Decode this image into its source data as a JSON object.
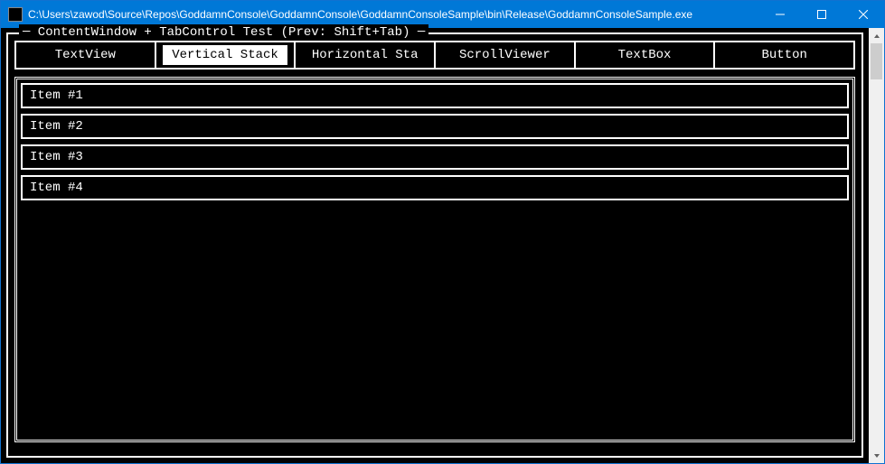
{
  "window": {
    "title": "C:\\Users\\zawod\\Source\\Repos\\GoddamnConsole\\GoddamnConsole\\GoddamnConsoleSample\\bin\\Release\\GoddamnConsoleSample.exe"
  },
  "frame": {
    "title": "─ ContentWindow + TabControl Test (Prev: Shift+Tab) ─"
  },
  "tabs": [
    {
      "label": "TextView",
      "active": false
    },
    {
      "label": "Vertical Stack",
      "active": true
    },
    {
      "label": "Horizontal Sta",
      "active": false
    },
    {
      "label": "ScrollViewer",
      "active": false
    },
    {
      "label": "TextBox",
      "active": false
    },
    {
      "label": "Button",
      "active": false
    }
  ],
  "items": [
    {
      "label": "Item #1"
    },
    {
      "label": "Item #2"
    },
    {
      "label": "Item #3"
    },
    {
      "label": "Item #4"
    }
  ]
}
